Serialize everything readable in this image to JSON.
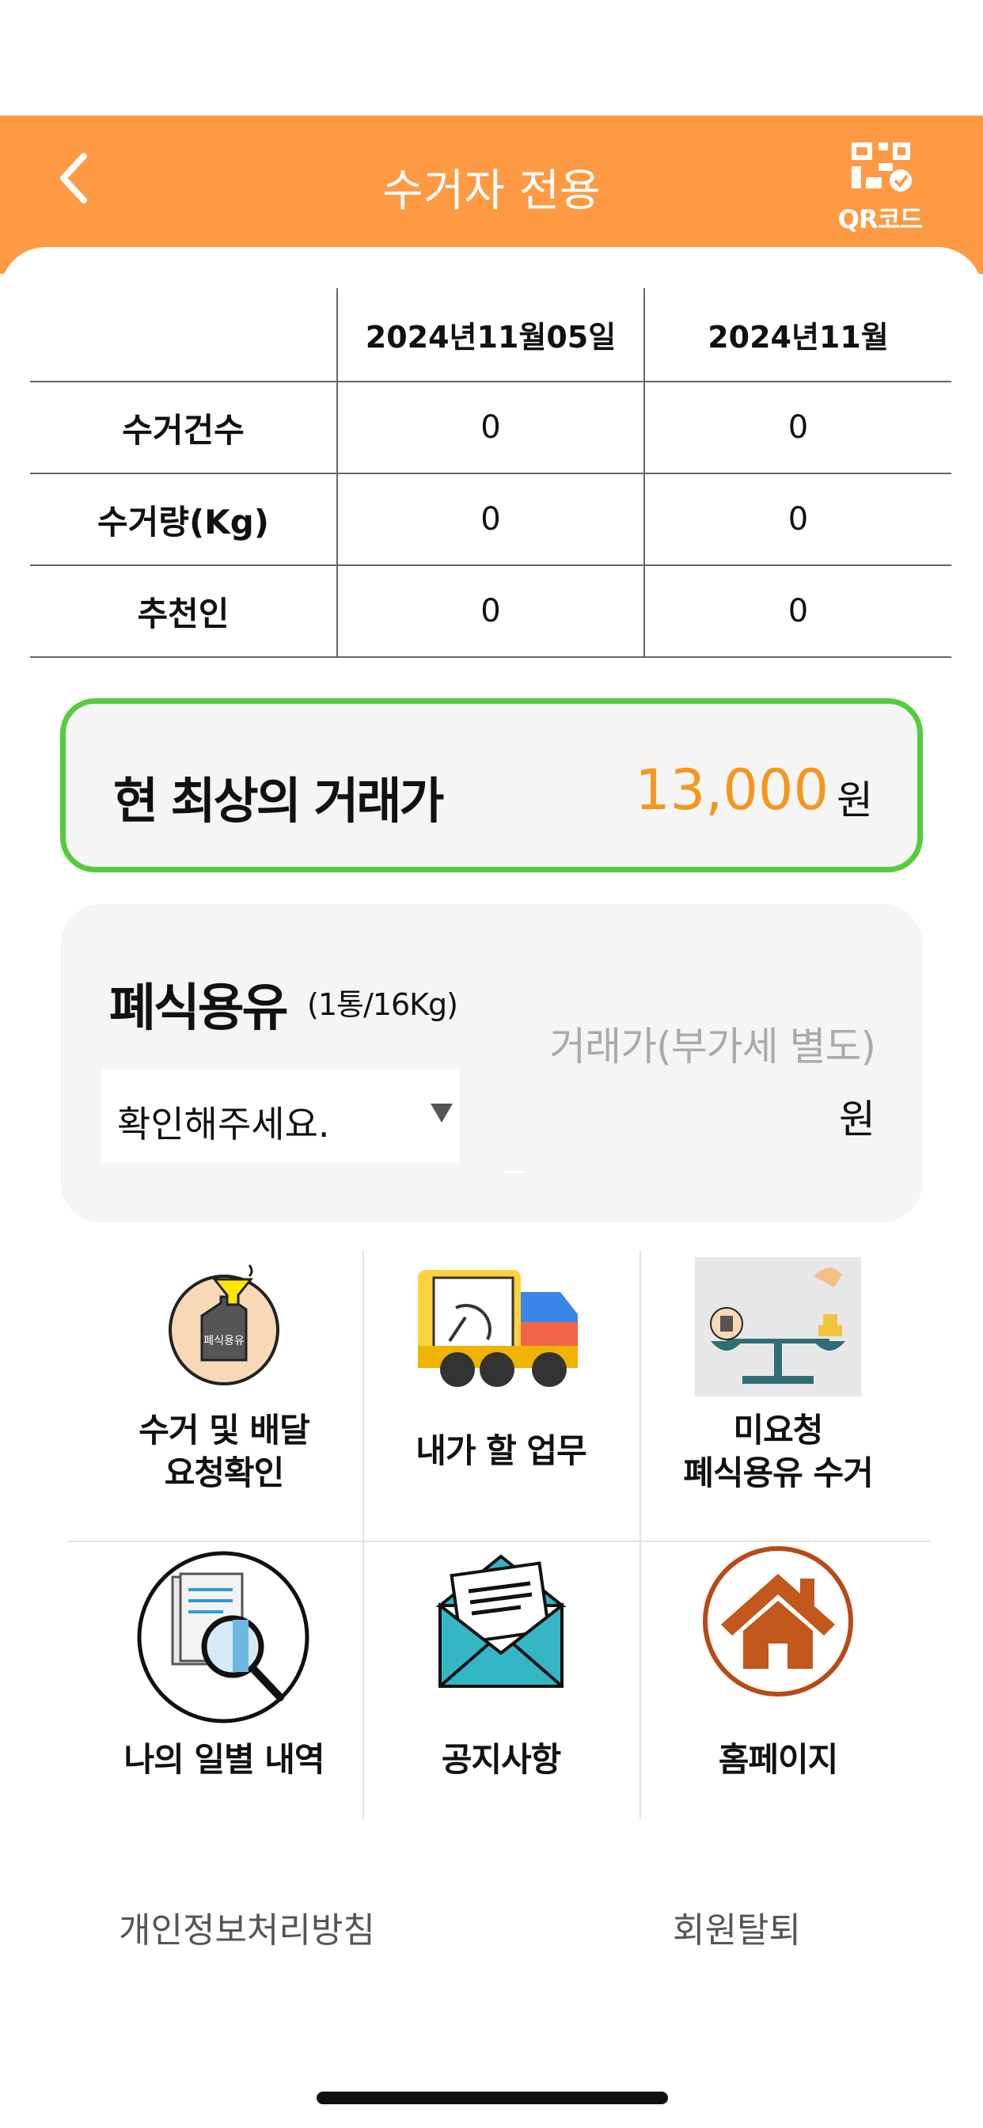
{
  "header": {
    "title": "수거자 전용",
    "qr_label": "QR코드",
    "background": "#fd9a43"
  },
  "stats": {
    "columns": [
      "",
      "2024년11월05일",
      "2024년11월"
    ],
    "rows": [
      {
        "label": "수거건수",
        "day": "0",
        "month": "0"
      },
      {
        "label": "수거량(Kg)",
        "day": "0",
        "month": "0"
      },
      {
        "label": "추천인",
        "day": "0",
        "month": "0"
      }
    ]
  },
  "best_price": {
    "label": "현 최상의 거래가",
    "value": "13,000",
    "unit": "원",
    "value_color": "#f7951d",
    "border_color": "#55cc3c"
  },
  "oil": {
    "title": "폐식용유",
    "subtitle": "(1통/16Kg)",
    "price_hint": "거래가(부가세 별도)",
    "select_value": "확인해주세요.",
    "unit": "원"
  },
  "menu": [
    {
      "label_line1": "수거 및 배달",
      "label_line2": "요청확인",
      "icon": "oil-can-funnel-icon"
    },
    {
      "label_line1": "내가 할 업무",
      "label_line2": "",
      "icon": "delivery-truck-icon"
    },
    {
      "label_line1": "미요청",
      "label_line2": "폐식용유 수거",
      "icon": "scale-icon"
    },
    {
      "label_line1": "나의 일별 내역",
      "label_line2": "",
      "icon": "document-search-icon"
    },
    {
      "label_line1": "공지사항",
      "label_line2": "",
      "icon": "envelope-icon"
    },
    {
      "label_line1": "홈페이지",
      "label_line2": "",
      "icon": "home-icon"
    }
  ],
  "footer": {
    "privacy": "개인정보처리방침",
    "withdraw": "회원탈퇴"
  }
}
